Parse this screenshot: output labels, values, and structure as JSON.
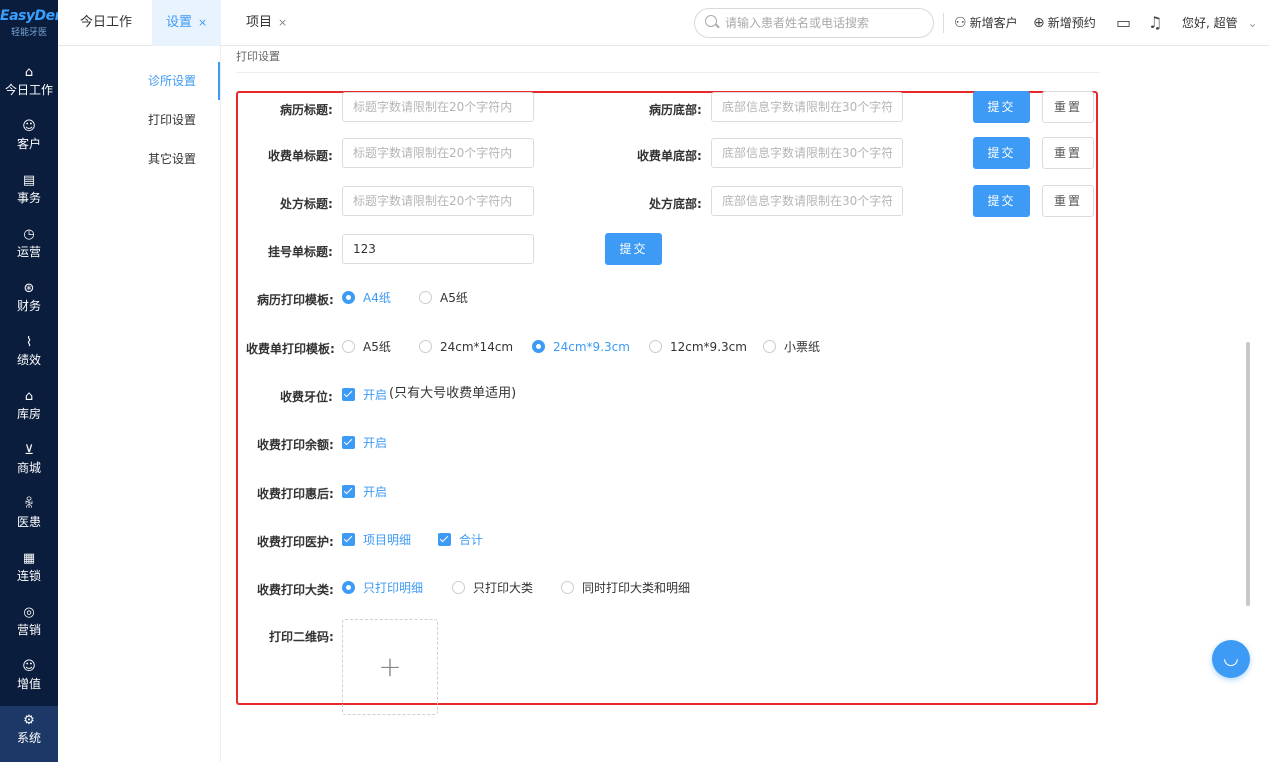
{
  "logo": {
    "brand": "EasyDent",
    "sub": "轻能牙医"
  },
  "sidebar": {
    "items": [
      {
        "label": "今日工作",
        "icon": "home-icon",
        "glyph": "⌂"
      },
      {
        "label": "客户",
        "icon": "user-icon",
        "glyph": "☺"
      },
      {
        "label": "事务",
        "icon": "clipboard-icon",
        "glyph": "▤"
      },
      {
        "label": "运营",
        "icon": "clock-icon",
        "glyph": "◷"
      },
      {
        "label": "财务",
        "icon": "finance-icon",
        "glyph": "⊛"
      },
      {
        "label": "绩效",
        "icon": "chart-icon",
        "glyph": "⌇"
      },
      {
        "label": "库房",
        "icon": "warehouse-icon",
        "glyph": "⌂"
      },
      {
        "label": "商城",
        "icon": "cart-icon",
        "glyph": "⊻"
      },
      {
        "label": "医患",
        "icon": "people-icon",
        "glyph": "ꆜ"
      },
      {
        "label": "连锁",
        "icon": "store-icon",
        "glyph": "▦"
      },
      {
        "label": "营销",
        "icon": "target-icon",
        "glyph": "◎"
      },
      {
        "label": "增值",
        "icon": "gift-icon",
        "glyph": "☺"
      },
      {
        "label": "系统",
        "icon": "gear-icon",
        "glyph": "⚙"
      }
    ]
  },
  "tabs": [
    {
      "label": "今日工作"
    },
    {
      "label": "设置",
      "close": "×"
    },
    {
      "label": "项目",
      "close": "×"
    }
  ],
  "search": {
    "placeholder": "请输入患者姓名或电话搜索"
  },
  "header_actions": {
    "add_customer": "新增客户",
    "add_appointment": "新增预约",
    "greeting": "您好, 超管"
  },
  "submenu": {
    "items": [
      {
        "label": "诊所设置"
      },
      {
        "label": "打印设置"
      },
      {
        "label": "其它设置"
      }
    ]
  },
  "section": {
    "title": "打印设置"
  },
  "form": {
    "record_title": {
      "label": "病历标题:",
      "placeholder": "标题字数请限制在20个字符内",
      "value": ""
    },
    "record_footer": {
      "label": "病历底部:",
      "placeholder": "底部信息字数请限制在30个字符内",
      "value": ""
    },
    "receipt_title": {
      "label": "收费单标题:",
      "placeholder": "标题字数请限制在20个字符内",
      "value": ""
    },
    "receipt_footer": {
      "label": "收费单底部:",
      "placeholder": "底部信息字数请限制在30个字符内",
      "value": ""
    },
    "rx_title": {
      "label": "处方标题:",
      "placeholder": "标题字数请限制在20个字符内",
      "value": ""
    },
    "rx_footer": {
      "label": "处方底部:",
      "placeholder": "底部信息字数请限制在30个字符内",
      "value": ""
    },
    "reg_title": {
      "label": "挂号单标题:",
      "value": "123"
    },
    "submit": "提交",
    "reset": "重置",
    "record_template": {
      "label": "病历打印模板:",
      "options": [
        "A4纸",
        "A5纸"
      ],
      "selected": "A4纸"
    },
    "receipt_template": {
      "label": "收费单打印模板:",
      "options": [
        "A5纸",
        "24cm*14cm",
        "24cm*9.3cm",
        "12cm*9.3cm",
        "小票纸"
      ],
      "selected": "24cm*9.3cm"
    },
    "tooth_position": {
      "label": "收费牙位:",
      "option": "开启",
      "note": "(只有大号收费单适用)",
      "checked": true
    },
    "print_balance": {
      "label": "收费打印余额:",
      "option": "开启",
      "checked": true
    },
    "print_discount": {
      "label": "收费打印惠后:",
      "option": "开启",
      "checked": true
    },
    "print_care": {
      "label": "收费打印医护:",
      "options": [
        "项目明细",
        "合计"
      ],
      "checked": [
        true,
        true
      ]
    },
    "print_category": {
      "label": "收费打印大类:",
      "options": [
        "只打印明细",
        "只打印大类",
        "同时打印大类和明细"
      ],
      "selected": "只打印明细"
    },
    "qr_code": {
      "label": "打印二维码:",
      "upload_symbol": "+"
    }
  },
  "colors": {
    "accent": "#3d9bf5",
    "sidebar": "#0a1d3d",
    "highlight_box": "#e8292c"
  }
}
